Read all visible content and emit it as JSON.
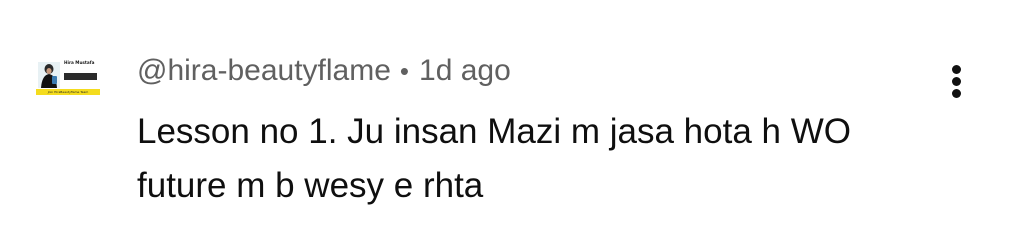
{
  "comment": {
    "avatar": {
      "name": "Hira Mustafa",
      "subtitle": "",
      "stats": "",
      "banner": "Join HiraBeautyflame Team",
      "banner_color": "#f4dc1e"
    },
    "author_handle": "@hira-beautyflame",
    "separator": "•",
    "timestamp": "1d ago",
    "text_lines": [
      "Lesson no 1. Ju insan Mazi m jasa hota h WO",
      "future m b wesy e rhta"
    ],
    "menu_icon": "more-vert-icon"
  },
  "colors": {
    "text_primary": "#0f0f0f",
    "text_secondary": "#606060",
    "background": "#ffffff"
  }
}
